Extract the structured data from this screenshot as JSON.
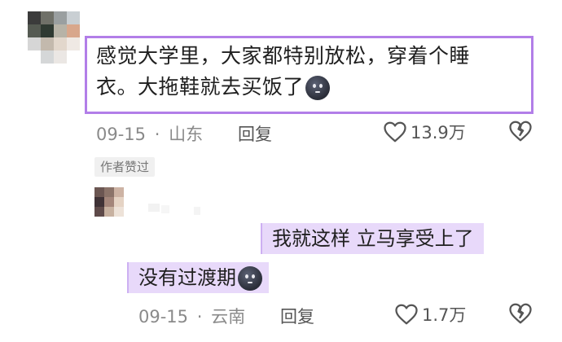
{
  "comment": {
    "text_line1": "感觉大学里，大家都特别放松，穿着个睡",
    "text_line2": "衣。大拖鞋就去买饭了",
    "emoji": "moon-face-emoji",
    "date": "09-15",
    "separator": "·",
    "location": "山东",
    "reply_label": "回复",
    "like_count": "13.9万",
    "author_badge": "作者赞过",
    "highlight_color": "#b27ee8"
  },
  "reply": {
    "text_line1": "我就这样 立马享受上了",
    "text_line2": "没有过渡期",
    "emoji": "moon-face-emoji",
    "date": "09-15",
    "separator": "·",
    "location": "云南",
    "reply_label": "回复",
    "like_count": "1.7万",
    "highlight_color": "#e8d9fa"
  }
}
